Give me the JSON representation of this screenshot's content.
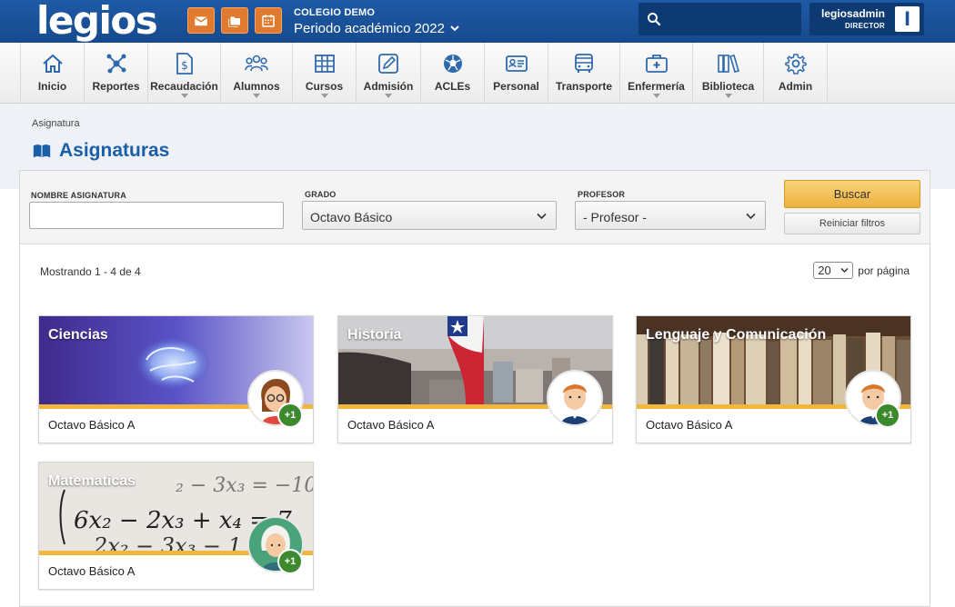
{
  "brand": {
    "logo_text": "legios"
  },
  "topbar": {
    "school_name": "COLEGIO DEMO",
    "period": "Periodo académico 2022",
    "user_name": "legiosadmin",
    "user_role": "DIRECTOR",
    "user_initial": "l",
    "quick_icons": [
      "mail-icon",
      "folder-icon",
      "calendar-icon"
    ],
    "accent_color": "#e07a2e",
    "brand_color": "#1d5299"
  },
  "nav": {
    "items": [
      {
        "label": "Inicio",
        "icon": "home-icon",
        "has_submenu": false
      },
      {
        "label": "Reportes",
        "icon": "network-icon",
        "has_submenu": false
      },
      {
        "label": "Recaudación",
        "icon": "invoice-dollar-icon",
        "has_submenu": true
      },
      {
        "label": "Alumnos",
        "icon": "users-icon",
        "has_submenu": true
      },
      {
        "label": "Cursos",
        "icon": "grid-table-icon",
        "has_submenu": true
      },
      {
        "label": "Admisión",
        "icon": "edit-icon",
        "has_submenu": true
      },
      {
        "label": "ACLEs",
        "icon": "soccer-ball-icon",
        "has_submenu": false
      },
      {
        "label": "Personal",
        "icon": "id-card-icon",
        "has_submenu": false
      },
      {
        "label": "Transporte",
        "icon": "bus-icon",
        "has_submenu": false
      },
      {
        "label": "Enfermería",
        "icon": "first-aid-kit-icon",
        "has_submenu": true
      },
      {
        "label": "Biblioteca",
        "icon": "books-icon",
        "has_submenu": true
      },
      {
        "label": "Admin",
        "icon": "gear-icon",
        "has_submenu": false
      }
    ]
  },
  "page": {
    "breadcrumb": "Asignatura",
    "title": "Asignaturas",
    "title_icon": "open-book-icon"
  },
  "filters": {
    "name_label": "NOMBRE ASIGNATURA",
    "name_value": "",
    "grade_label": "GRADO",
    "grade_value": "Octavo Básico",
    "teacher_label": "PROFESOR",
    "teacher_value": "- Profesor -",
    "search_button": "Buscar",
    "reset_button": "Reiniciar filtros"
  },
  "results": {
    "summary": "Mostrando 1 - 4 de 4",
    "per_page_value": "20",
    "per_page_label": "por página"
  },
  "cards": [
    {
      "title": "Ciencias",
      "subtitle": "Octavo Básico A",
      "image": "brain-image",
      "avatar": "teacher-woman-glasses-avatar",
      "extra": "+1"
    },
    {
      "title": "Historia",
      "subtitle": "Octavo Básico A",
      "image": "chile-flag-city-image",
      "avatar": "teacher-man-avatar",
      "extra": ""
    },
    {
      "title": "Lenguaje y Comunicación",
      "subtitle": "Octavo Básico A",
      "image": "books-shelf-image",
      "avatar": "teacher-man-avatar",
      "extra": "+1"
    },
    {
      "title": "Matematicas",
      "subtitle": "Octavo Básico A",
      "image": "equations-image",
      "avatar": "teacher-old-woman-avatar",
      "extra": "+1"
    }
  ]
}
